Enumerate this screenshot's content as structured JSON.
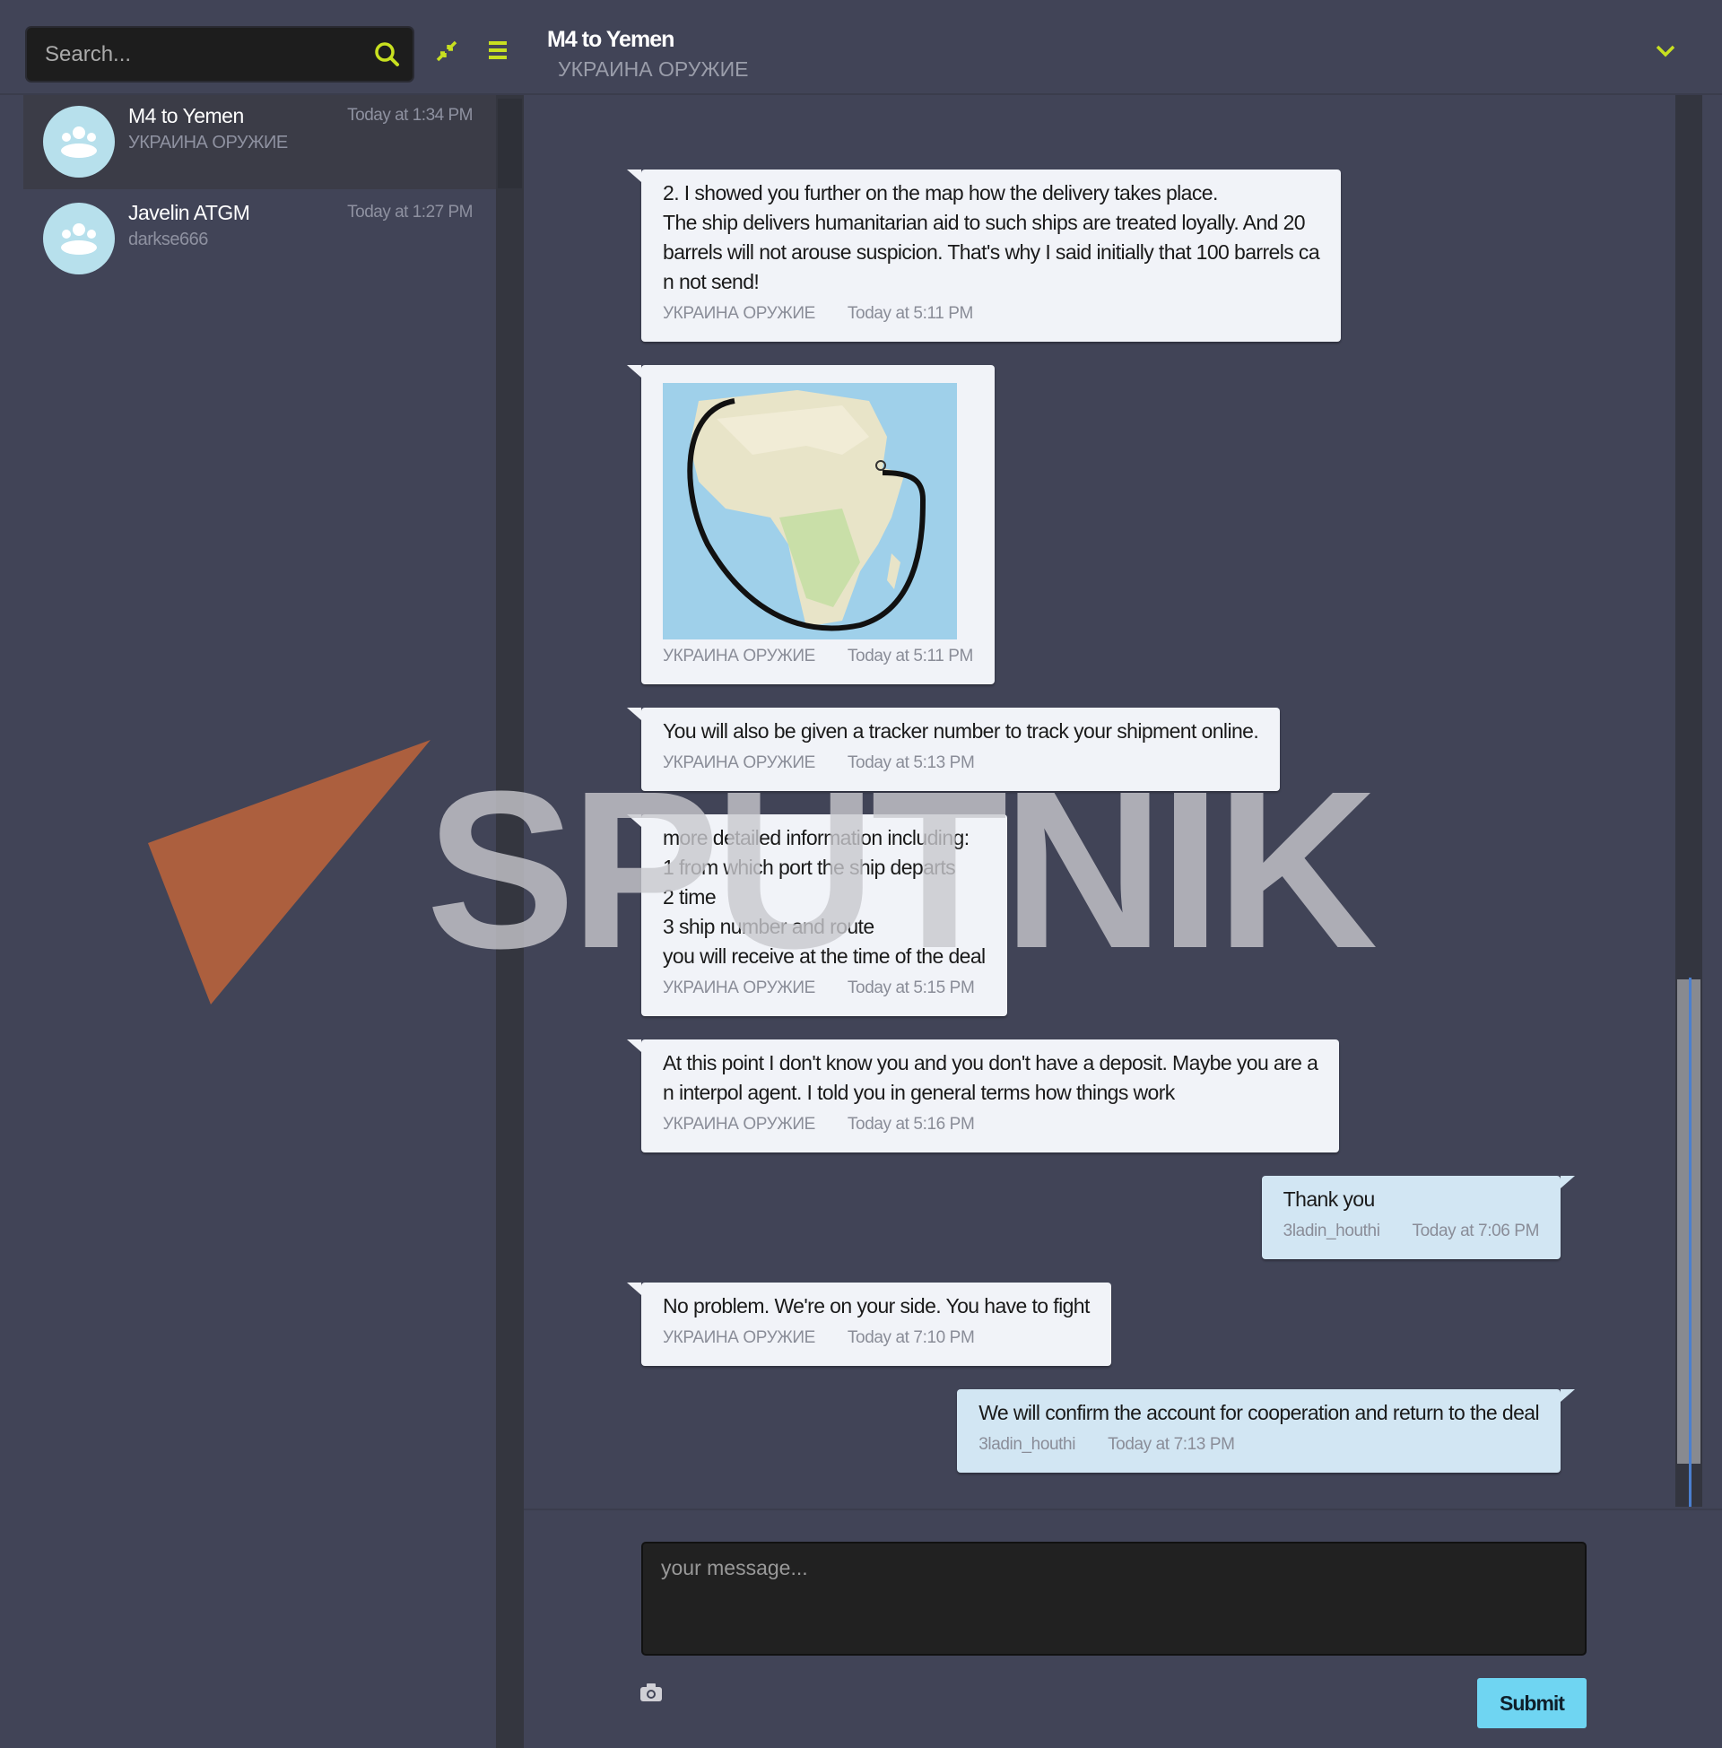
{
  "sidebar": {
    "search_placeholder": "Search...",
    "icons": {
      "search": "search-icon",
      "compress": "compress-arrows-icon",
      "menu": "hamburger-menu-icon"
    },
    "conversations": [
      {
        "name": "M4 to Yemen",
        "subtitle": "УКРАИНА ОРУЖИЕ",
        "time": "Today at 1:34 PM",
        "selected": true
      },
      {
        "name": "Javelin ATGM",
        "subtitle": "darkse666",
        "time": "Today at 1:27 PM",
        "selected": false
      }
    ]
  },
  "header": {
    "title": "M4 to Yemen",
    "subtitle": "УКРАИНА ОРУЖИЕ",
    "icon": "chevron-down-icon"
  },
  "messages": [
    {
      "text": "2. I showed you further on the map how the delivery takes place.\nThe ship delivers humanitarian aid to such ships are treated loyally. And 20\nbarrels will not arouse suspicion. That's why I said initially that 100 barrels ca\nn not send!",
      "sender": "УКРАИНА ОРУЖИЕ",
      "time": "Today at 5:11 PM",
      "own": false
    },
    {
      "text": "",
      "image": "map-africa-route",
      "sender": "УКРАИНА ОРУЖИЕ",
      "time": "Today at 5:11 PM",
      "own": false
    },
    {
      "text": "You will also be given a tracker number to track your shipment online.",
      "sender": "УКРАИНА ОРУЖИЕ",
      "time": "Today at 5:13 PM",
      "own": false
    },
    {
      "text": "more detailed information including:\n1 from which port the ship departs\n2 time\n3 ship number and route\nyou will receive at the time of the deal",
      "sender": "УКРАИНА ОРУЖИЕ",
      "time": "Today at 5:15 PM",
      "own": false
    },
    {
      "text": "At this point I don't know you and you don't have a deposit. Maybe you are a\nn interpol agent. I told you in general terms how things work",
      "sender": "УКРАИНА ОРУЖИЕ",
      "time": "Today at 5:16 PM",
      "own": false
    },
    {
      "text": "Thank you",
      "sender": "3ladin_houthi",
      "time": "Today at 7:06 PM",
      "own": true
    },
    {
      "text": "No problem. We're on your side. You have to fight",
      "sender": "УКРАИНА ОРУЖИЕ",
      "time": "Today at 7:10 PM",
      "own": false
    },
    {
      "text": "We will confirm the account for cooperation and return to the deal",
      "sender": "3ladin_houthi",
      "time": "Today at 7:13 PM",
      "own": true
    }
  ],
  "composer": {
    "placeholder": "your message...",
    "submit_label": "Submit",
    "attach_icon": "camera-icon"
  },
  "watermark": "SPUTNIK",
  "colors": {
    "accent": "#c8e020",
    "submit": "#6fd5f2",
    "bubble": "#f1f3f8",
    "own_bubble": "#d2e6f3",
    "background": "#414457"
  }
}
